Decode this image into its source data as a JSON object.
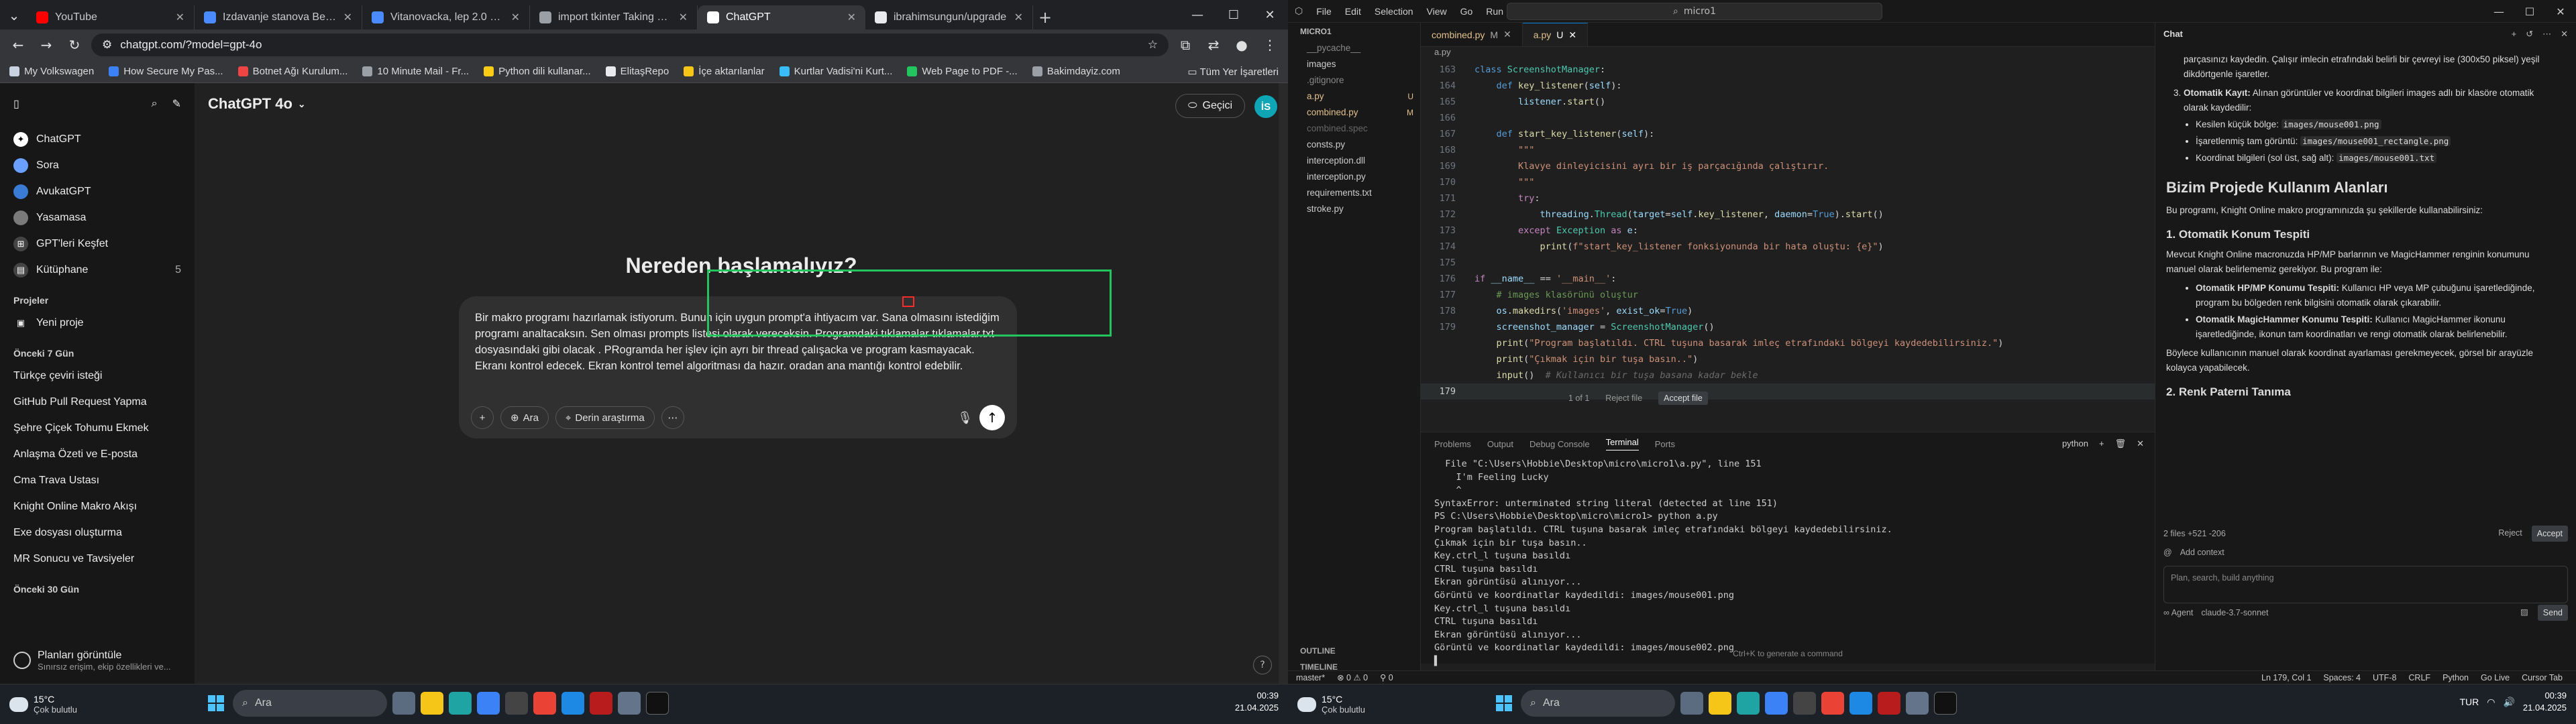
{
  "chrome": {
    "tabs": [
      {
        "title": "YouTube",
        "color": "#ff0000"
      },
      {
        "title": "Izdavanje stanova Beograd | Ha...",
        "color": "#4a8cff"
      },
      {
        "title": "Vitanovacka, lep 2.0 stan | Halo...",
        "color": "#4a8cff"
      },
      {
        "title": "import tkinter Taking Notes and...",
        "color": "#9aa0a6"
      },
      {
        "title": "ChatGPT",
        "color": "#ffffff"
      },
      {
        "title": "ibrahimsungun/upgrade",
        "color": "#e8eaed"
      }
    ],
    "url": "chatgpt.com/?model=gpt-4o",
    "bookmarks": [
      {
        "label": "My Volkswagen",
        "color": "#c9d3e0"
      },
      {
        "label": "How Secure My Pas...",
        "color": "#3b82f6"
      },
      {
        "label": "Botnet Ağı Kurulum...",
        "color": "#ef4444"
      },
      {
        "label": "10 Minute Mail - Fr...",
        "color": "#9aa0a6"
      },
      {
        "label": "Python dili kullanar...",
        "color": "#facc15"
      },
      {
        "label": "ElitaşRepo",
        "color": "#e8eaed"
      },
      {
        "label": "İçe aktarılanlar",
        "color": "#f5c518"
      },
      {
        "label": "Kurtlar Vadisi'ni Kurt...",
        "color": "#38bdf8"
      },
      {
        "label": "Web Page to PDF -...",
        "color": "#22c55e"
      },
      {
        "label": "Bakimdayiz.com",
        "color": "#9aa0a6"
      }
    ],
    "all_bookmarks": "Tüm Yer İşaretleri"
  },
  "chatgpt": {
    "model": "ChatGPT 4o",
    "temp_button": "Geçici",
    "avatar": "İS",
    "nav": [
      {
        "label": "ChatGPT",
        "color": "#ffffff",
        "glyph": "✦"
      },
      {
        "label": "Sora",
        "color": "#6aa0ff",
        "glyph": ""
      },
      {
        "label": "AvukatGPT",
        "color": "#3a7bd5",
        "glyph": ""
      },
      {
        "label": "Yasamasa",
        "color": "#7a7a7a",
        "glyph": ""
      },
      {
        "label": "GPT'leri Keşfet",
        "color": "#444444",
        "glyph": "⊞"
      },
      {
        "label": "Kütüphane",
        "color": "#444444",
        "glyph": "▤",
        "count": "5"
      }
    ],
    "projects_header": "Projeler",
    "new_project": "Yeni proje",
    "recent7_header": "Önceki 7 Gün",
    "recent7": [
      "Türkçe çeviri isteği",
      "GitHub Pull Request Yapma",
      "Şehre Çiçek Tohumu Ekmek",
      "Anlaşma Özeti ve E-posta",
      "Cma Trava Ustası",
      "Knight Online Makro Akışı",
      "Exe dosyası oluşturma",
      "MR Sonucu ve Tavsiyeler"
    ],
    "recent30_header": "Önceki 30 Gün",
    "plans_title": "Planları görüntüle",
    "plans_sub": "Sınırsız erişim, ekip özellikleri ve...",
    "hero": "Nereden başlamalıyız?",
    "prompt": "Bir makro programı hazırlamak istiyorum. Bunun için uygun prompt'a ihtiyacım var. Sana olmasını istediğim programı analtacaksın. Sen olması prompts listesi olarak vereceksin. Programdaki tıklamalar tıklamalar.txt dosyasındaki gibi olacak . PRogramda her işlev için ayrı bir thread çalışacka ve program kasmayacak. Ekranı kontrol edecek. Ekran kontrol temel algoritması da hazır. oradan ana mantığı kontrol edebilir.",
    "btn_search": "Ara",
    "btn_research": "Derin araştırma",
    "help": "?"
  },
  "taskbar1": {
    "temp": "15°C",
    "weather": "Çok bulutlu",
    "search": "Ara",
    "time": "00:39",
    "date": "21.04.2025"
  },
  "taskbar2": {
    "temp": "15°C",
    "weather": "Çok bulutlu",
    "search": "Ara",
    "lang": "TUR",
    "time": "00:39",
    "date": "21.04.2025"
  },
  "vscode": {
    "menu": [
      "File",
      "Edit",
      "Selection",
      "View",
      "Go",
      "Run",
      "Terminal",
      "Help"
    ],
    "search": "micro1",
    "explorer_root": "MICRO1",
    "files": [
      {
        "name": "__pycache__",
        "color": "#888888",
        "badge": ""
      },
      {
        "name": "images",
        "color": "#cccccc",
        "badge": ""
      },
      {
        "name": ".gitignore",
        "color": "#888888",
        "badge": ""
      },
      {
        "name": "a.py",
        "color": "#e2c08d",
        "badge": "U"
      },
      {
        "name": "combined.py",
        "color": "#e2c08d",
        "badge": "M"
      },
      {
        "name": "combined.spec",
        "color": "#666666",
        "badge": ""
      },
      {
        "name": "consts.py",
        "color": "#cccccc",
        "badge": ""
      },
      {
        "name": "interception.dll",
        "color": "#cccccc",
        "badge": ""
      },
      {
        "name": "interception.py",
        "color": "#cccccc",
        "badge": ""
      },
      {
        "name": "requirements.txt",
        "color": "#cccccc",
        "badge": ""
      },
      {
        "name": "stroke.py",
        "color": "#cccccc",
        "badge": ""
      }
    ],
    "outline": "OUTLINE",
    "timeline": "TIMELINE",
    "tabs": [
      {
        "name": "combined.py",
        "badge": "M"
      },
      {
        "name": "a.py",
        "badge": "U"
      }
    ],
    "breadcrumb": "a.py",
    "lines": [
      "163",
      "164",
      "165",
      "166",
      "167",
      "168",
      "169",
      "170",
      "171",
      "172",
      "173",
      "174",
      "175",
      "176",
      "177",
      "178",
      "179"
    ],
    "diff_count": "1 of 1",
    "reject_file": "Reject file",
    "accept_file": "Accept file",
    "panel_tabs": [
      "Problems",
      "Output",
      "Debug Console",
      "Terminal",
      "Ports"
    ],
    "terminal_shell": "python",
    "terminal": [
      "  File \"C:\\Users\\Hobbie\\Desktop\\micro\\micro1\\a.py\", line 151",
      "    I'm Feeling Lucky",
      "    ^",
      "SyntaxError: unterminated string literal (detected at line 151)",
      "PS C:\\Users\\Hobbie\\Desktop\\micro\\micro1> python a.py",
      "Program başlatıldı. CTRL tuşuna basarak imleç etrafındaki bölgeyi kaydedebilirsiniz.",
      "Çıkmak için bir tuşa basın..",
      "Key.ctrl_l tuşuna basıldı",
      "CTRL tuşuna basıldı",
      "Ekran görüntüsü alınıyor...",
      "Görüntü ve koordinatlar kaydedildi: images/mouse001.png",
      "Key.ctrl_l tuşuna basıldı",
      "CTRL tuşuna basıldı",
      "Ekran görüntüsü alınıyor...",
      "Görüntü ve koordinatlar kaydedildi: images/mouse002.png",
      "▌"
    ],
    "terminal_hint": "Ctrl+K to generate a command",
    "status_left": [
      "master*",
      "⊗ 0 ⚠ 0",
      "⚲ 0"
    ],
    "status_right": [
      "Ln 179, Col 1",
      "Spaces: 4",
      "UTF-8",
      "CRLF",
      "Python",
      "Go Live",
      "Cursor Tab"
    ]
  },
  "chat": {
    "title": "Chat",
    "intro": "parçasınızı kaydedin. Çalışır imlecin etrafındaki belirli bir çevreyi ise (300x50 piksel) yeşil dikdörtgenle işaretler.",
    "step3": "Otomatik Kayıt:",
    "step3_text": "Alınan görüntüler ve koordinat bilgileri images adlı bir klasöre otomatik olarak kaydedilir:",
    "bullets": [
      {
        "pre": "Kesilen küçük bölge:",
        "code": "images/mouse001.png"
      },
      {
        "pre": "İşaretlenmiş tam görüntü:",
        "code": "images/mouse001_rectangle.png"
      },
      {
        "pre": "Koordinat bilgileri (sol üst, sağ alt):",
        "code": "images/mouse001.txt"
      }
    ],
    "h2": "Bizim Projede Kullanım Alanları",
    "p1": "Bu programı, Knight Online makro programınızda şu şekillerde kullanabilirsiniz:",
    "h3a": "1. Otomatik Konum Tespiti",
    "p2": "Mevcut Knight Online macronuzda HP/MP barlarının ve MagicHammer renginin konumunu manuel olarak belirlememiz gerekiyor. Bu program ile:",
    "b2": [
      {
        "bold": "Otomatik HP/MP Konumu Tespiti:",
        "text": "Kullanıcı HP veya MP çubuğunu işaretlediğinde, program bu bölgeden renk bilgisini otomatik olarak çıkarabilir."
      },
      {
        "bold": "Otomatik MagicHammer Konumu Tespiti:",
        "text": "Kullanıcı MagicHammer ikonunu işaretlediğinde, ikonun tam koordinatları ve rengi otomatik olarak belirlenebilir."
      }
    ],
    "p3": "Böylece kullanıcının manuel olarak koordinat ayarlaması gerekmeyecek, görsel bir arayüzle kolayca yapabilecek.",
    "h3b": "2. Renk Paterni Tanıma",
    "files_changed": "2 files +521 -206",
    "reject": "Reject",
    "accept": "Accept",
    "add_context": "Add context",
    "placeholder": "Plan, search, build anything",
    "agent": "Agent",
    "model": "claude-3.7-sonnet",
    "send": "Send"
  }
}
